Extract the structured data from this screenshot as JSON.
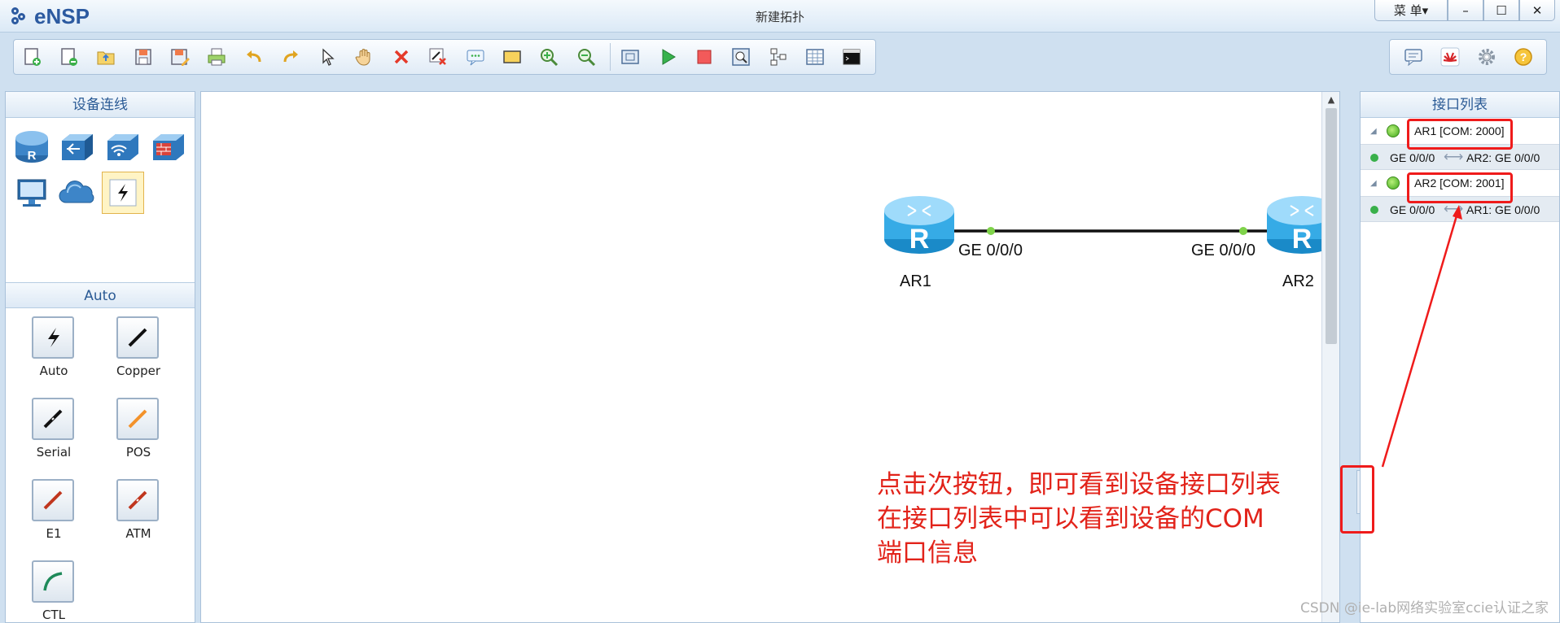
{
  "app": {
    "logo_text": "eNSP",
    "window_title": "新建拓扑",
    "menu_label": "菜 单▾",
    "minimize": "–",
    "maximize": "☐",
    "close": "✕"
  },
  "toolbar": {
    "left_icons": [
      "new-topology-icon",
      "new-example-icon",
      "open-icon",
      "save-icon",
      "save-as-icon",
      "print-icon",
      "undo-icon",
      "redo-icon",
      "select-icon",
      "pan-hand-icon",
      "delete-icon",
      "delete-link-icon",
      "text-icon",
      "rectangle-icon",
      "zoom-in-icon",
      "zoom-out-icon",
      "fit-icon",
      "start-icon",
      "stop-icon",
      "capture-icon",
      "topology-icon",
      "grid-icon",
      "terminal-icon"
    ],
    "right_icons": [
      "message-icon",
      "huawei-logo-icon",
      "settings-gear-icon",
      "help-icon"
    ]
  },
  "left_panel": {
    "device_header": "设备连线",
    "devices": [
      "router-icon",
      "switch-icon",
      "wireless-icon",
      "firewall-icon",
      "pc-icon",
      "cloud-icon",
      "cable-connection-icon"
    ],
    "cables_header": "Auto",
    "cables": [
      {
        "label": "Auto",
        "icon": "auto-cable-icon"
      },
      {
        "label": "Copper",
        "icon": "copper-cable-icon"
      },
      {
        "label": "Serial",
        "icon": "serial-cable-icon"
      },
      {
        "label": "POS",
        "icon": "pos-cable-icon"
      },
      {
        "label": "E1",
        "icon": "e1-cable-icon"
      },
      {
        "label": "ATM",
        "icon": "atm-cable-icon"
      },
      {
        "label": "CTL",
        "icon": "ctl-cable-icon"
      }
    ]
  },
  "canvas": {
    "router1": {
      "label": "AR1",
      "port": "GE 0/0/0"
    },
    "router2": {
      "label": "AR2",
      "port": "GE 0/0/0"
    },
    "annotation": "点击次按钮，即可看到设备接口列表\n在接口列表中可以看到设备的COM\n端口信息",
    "collapse_button": "›"
  },
  "right_panel": {
    "header": "接口列表",
    "devices": [
      {
        "name": "AR1 [COM: 2000]",
        "link_left": "GE 0/0/0",
        "link_right": "AR2: GE 0/0/0"
      },
      {
        "name": "AR2 [COM: 2001]",
        "link_left": "GE 0/0/0",
        "link_right": "AR1: GE 0/0/0"
      }
    ]
  },
  "colors": {
    "accent": "#2a5a95",
    "annotation_red": "#e2231a",
    "link_up": "#39b04a"
  },
  "watermark": "CSDN @ie-lab网络实验室ccie认证之家"
}
